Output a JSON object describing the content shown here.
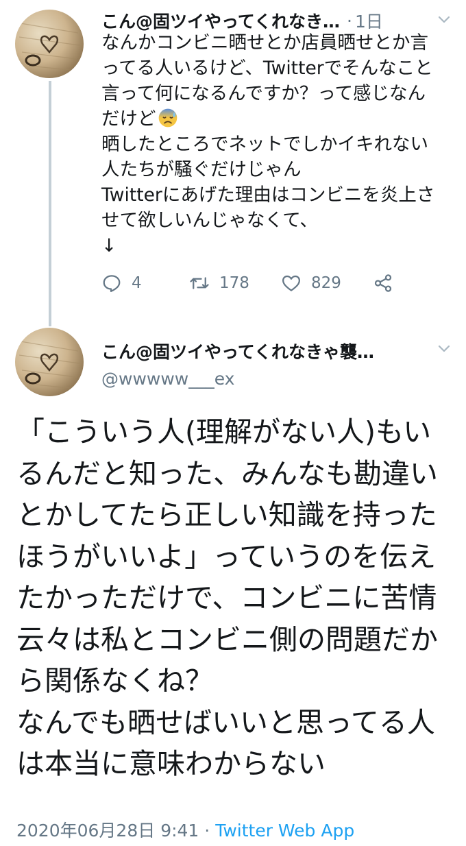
{
  "tweet1": {
    "author": "こん@固ツイやってくれなき…",
    "time": "1日",
    "separator": "·",
    "text_lines": [
      "なんかコンビニ晒せとか店員晒せとか言",
      "ってる人いるけど、Twitterでそんなこと",
      "言って何になるんですか？って感じなん",
      "だけど",
      "晒したところでネットでしかイキれない",
      "人たちが騒ぐだけじゃん",
      "Twitterにあげた理由はコンビニを炎上さ",
      "せて欲しいんじゃなくて、",
      "↓"
    ],
    "emoji": "anxious-face-with-sweat",
    "reply_count": "4",
    "retweet_count": "178",
    "like_count": "829"
  },
  "tweet2": {
    "author": "こん@固ツイやってくれなきゃ襲…",
    "handle": "@wwwww___ex",
    "text_lines": [
      "「こういう人(理解がない人)もい",
      "るんだと知った、みんなも勘違い",
      "とかしてたら正しい知識を持った",
      "ほうがいいよ」っていうのを伝え",
      "たかっただけで、コンビニに苦情",
      "云々は私とコンビニ側の問題だか",
      "ら関係なくね？",
      "なんでも晒せばいいと思ってる人",
      "は本当に意味わからない"
    ],
    "timestamp": "2020年06月28日 9:41",
    "separator": " · ",
    "source_app": "Twitter Web App"
  },
  "colors": {
    "text": "#14171a",
    "muted": "#657786",
    "link": "#1da1f2",
    "thread_line": "#c4cfd6"
  }
}
